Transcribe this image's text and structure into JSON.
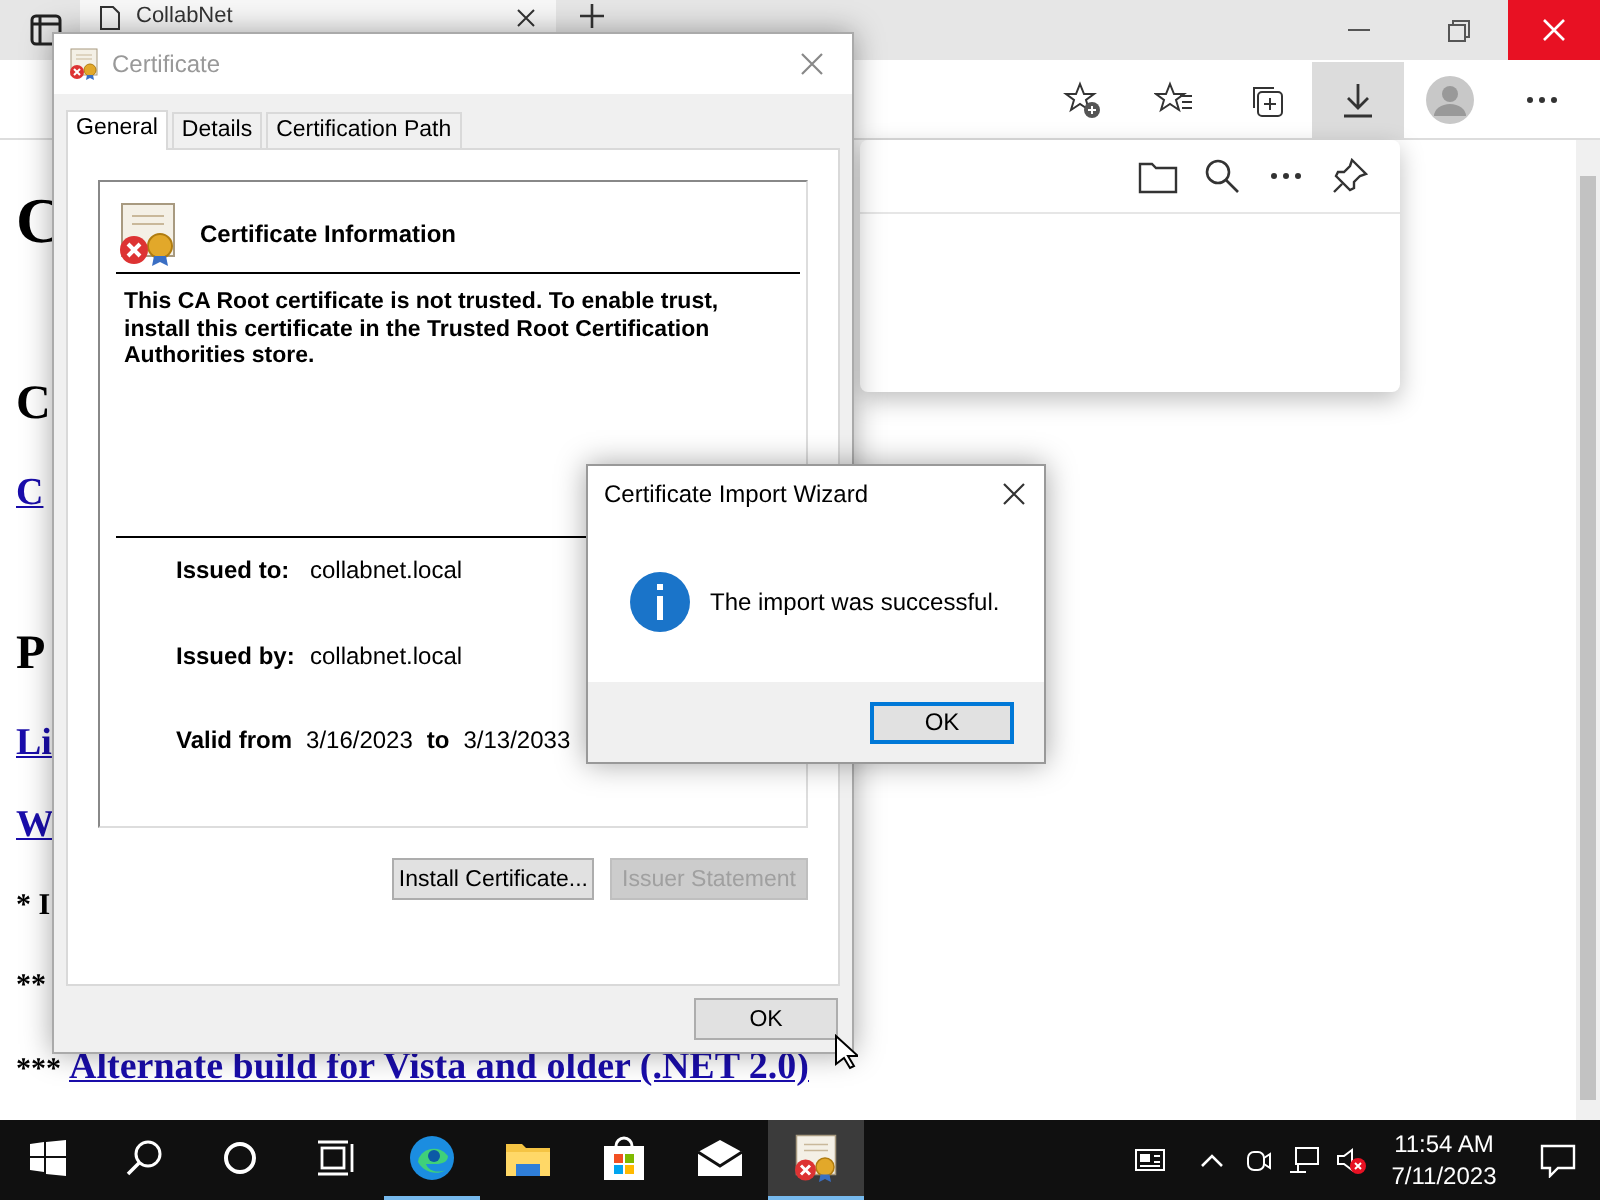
{
  "browser": {
    "tab_title": "CollabNet",
    "page": {
      "rows": [
        {
          "kind": "heading",
          "text": "C"
        },
        {
          "kind": "subheading",
          "text": "C"
        },
        {
          "kind": "link",
          "text": "C"
        },
        {
          "kind": "subheading",
          "text": "P"
        },
        {
          "kind": "link",
          "text": "Li"
        },
        {
          "kind": "link",
          "text": "W"
        },
        {
          "kind": "note",
          "text": "* I"
        },
        {
          "kind": "note",
          "text": "**"
        },
        {
          "kind": "note_link",
          "text": "***",
          "link": "Alternate build for Vista and older (.NET 2.0)"
        }
      ]
    }
  },
  "certificate_dialog": {
    "title": "Certificate",
    "tabs": [
      {
        "label": "General",
        "selected": true
      },
      {
        "label": "Details",
        "selected": false
      },
      {
        "label": "Certification Path",
        "selected": false
      }
    ],
    "heading": "Certificate Information",
    "message": "This CA Root certificate is not trusted. To enable trust, install this certificate in the Trusted Root Certification Authorities store.",
    "fields": [
      {
        "label": "Issued to:",
        "value": "collabnet.local"
      },
      {
        "label": "Issued by:",
        "value": "collabnet.local"
      }
    ],
    "validity": {
      "label": "Valid from",
      "from": "3/16/2023",
      "to_label": "to",
      "to": "3/13/2033"
    },
    "buttons": [
      {
        "label": "Install Certificate...",
        "disabled": false
      },
      {
        "label": "Issuer Statement",
        "disabled": true
      }
    ],
    "ok": "OK"
  },
  "wizard": {
    "title": "Certificate Import Wizard",
    "message": "The import was successful.",
    "ok": "OK"
  },
  "taskbar": {
    "apps": [
      {
        "kind": "edge",
        "running": true,
        "active": false
      },
      {
        "kind": "folder",
        "running": false,
        "active": false
      },
      {
        "kind": "store",
        "running": false,
        "active": false
      },
      {
        "kind": "mail",
        "running": false,
        "active": false
      },
      {
        "kind": "certificate",
        "running": true,
        "active": true
      }
    ],
    "time": "11:54 AM",
    "date": "7/11/2023"
  }
}
